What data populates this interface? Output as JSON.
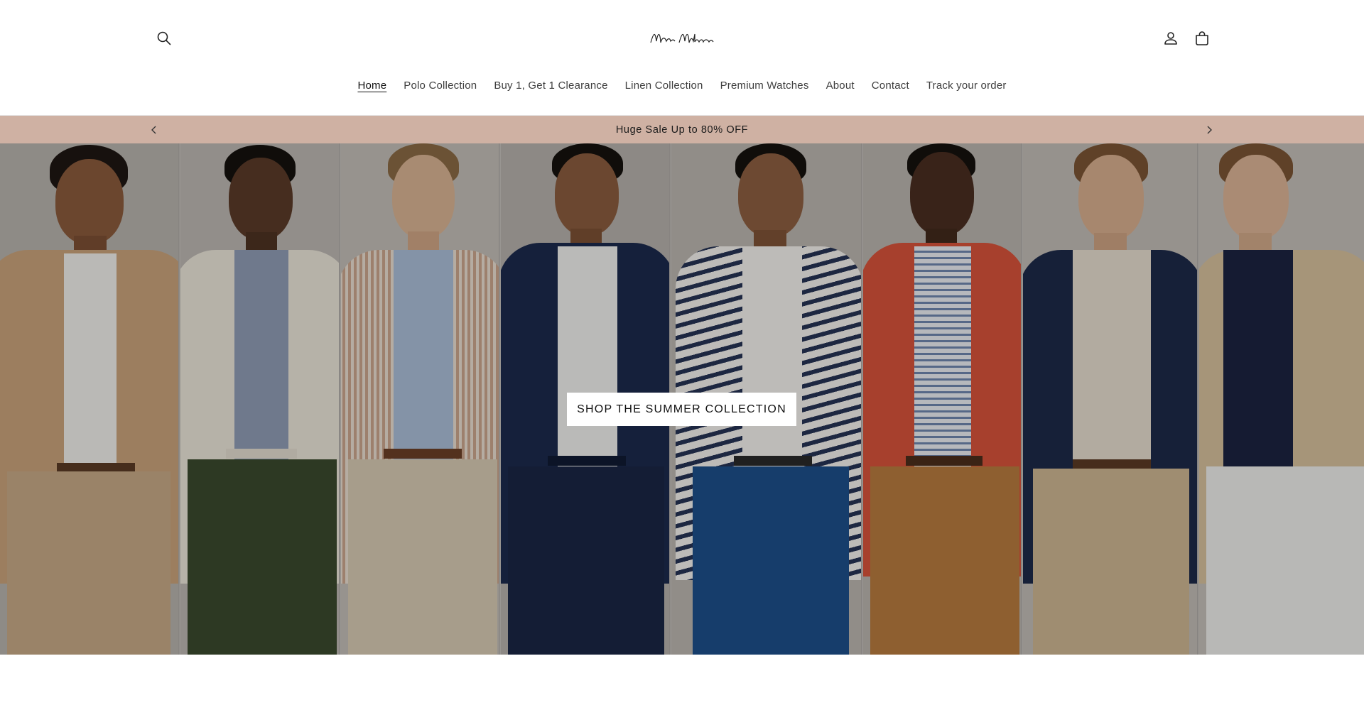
{
  "header": {
    "logo_text": "Moda Milano",
    "icons": {
      "search": "search-icon",
      "account": "account-icon",
      "cart": "cart-icon"
    }
  },
  "nav": {
    "items": [
      {
        "label": "Home",
        "active": true
      },
      {
        "label": "Polo Collection",
        "active": false
      },
      {
        "label": "Buy 1, Get 1 Clearance",
        "active": false
      },
      {
        "label": "Linen Collection",
        "active": false
      },
      {
        "label": "Premium Watches",
        "active": false
      },
      {
        "label": "About",
        "active": false
      },
      {
        "label": "Contact",
        "active": false
      },
      {
        "label": "Track your order",
        "active": false
      }
    ]
  },
  "announcement": {
    "text": "Huge Sale Up to 80% OFF",
    "background": "#cfb1a3",
    "prev_icon": "chevron-left-icon",
    "next_icon": "chevron-right-icon"
  },
  "hero": {
    "cta_label": "SHOP THE SUMMER COLLECTION",
    "image_description_icon": "hero-image"
  }
}
